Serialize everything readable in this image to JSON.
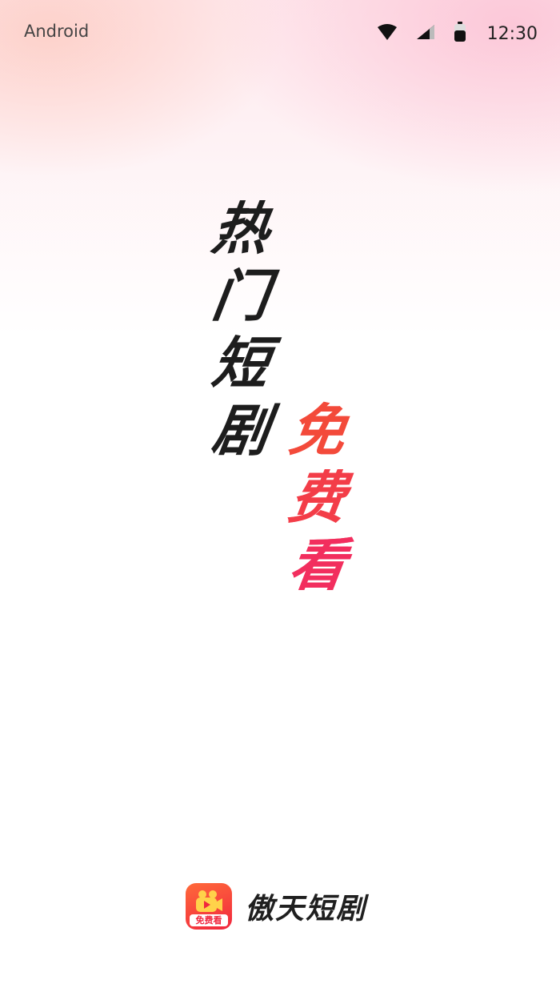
{
  "status_bar": {
    "carrier": "Android",
    "time": "12:30",
    "icons": [
      "wifi-icon",
      "cellular-signal-icon",
      "battery-icon"
    ]
  },
  "slogan": {
    "column_1": [
      "热",
      "门",
      "短",
      "剧"
    ],
    "column_2": [
      "免",
      "费",
      "看"
    ]
  },
  "brand": {
    "logo_badge": "免费看",
    "name": "傲天短剧"
  },
  "colors": {
    "accent": "#f33a4a",
    "text_dark": "#1d1d1d",
    "logo_gradient_start": "#ff6a3a",
    "logo_gradient_end": "#f1263e"
  }
}
